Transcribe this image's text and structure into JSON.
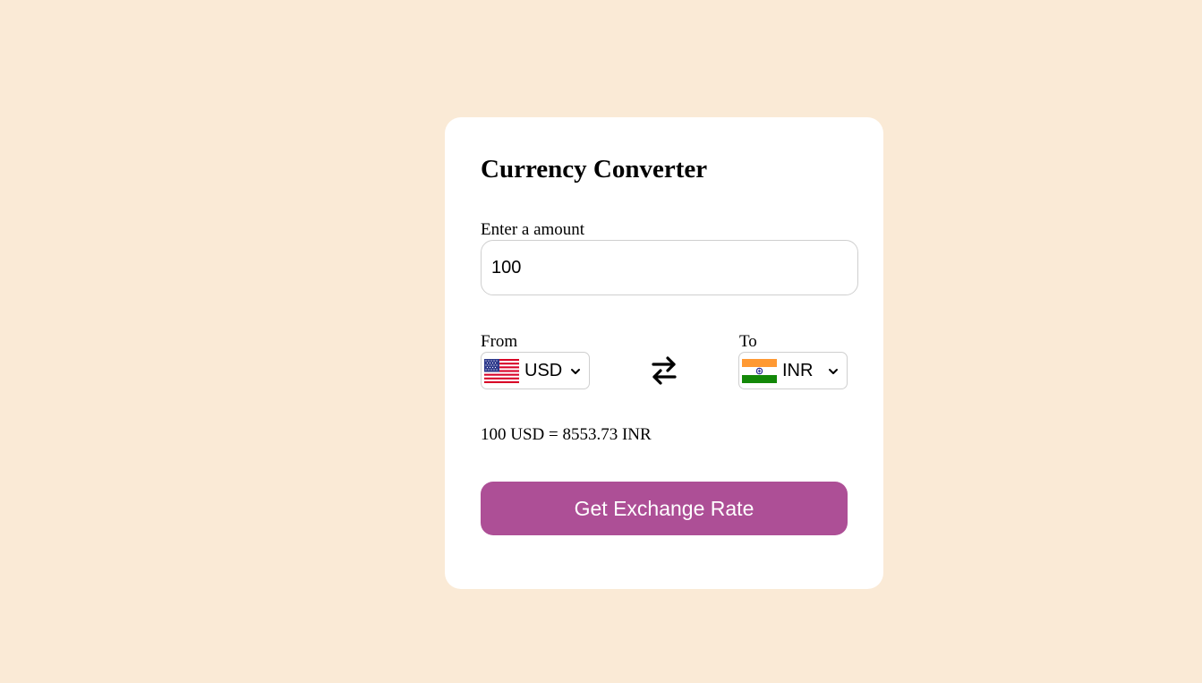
{
  "app": {
    "title": "Currency Converter"
  },
  "amount": {
    "label": "Enter a amount",
    "value": "100"
  },
  "from": {
    "label": "From",
    "currency": "USD",
    "flag_icon": "us-flag-icon"
  },
  "to": {
    "label": "To",
    "currency": "INR",
    "flag_icon": "india-flag-icon"
  },
  "swap": {
    "icon": "swap-arrows-icon"
  },
  "result": {
    "text": "100 USD = 8553.73 INR"
  },
  "action": {
    "button_label": "Get Exchange Rate"
  },
  "colors": {
    "background": "#faead6",
    "card": "#ffffff",
    "button": "#ad4f96",
    "button_text": "#ffffff",
    "border": "#cfcfcf"
  }
}
